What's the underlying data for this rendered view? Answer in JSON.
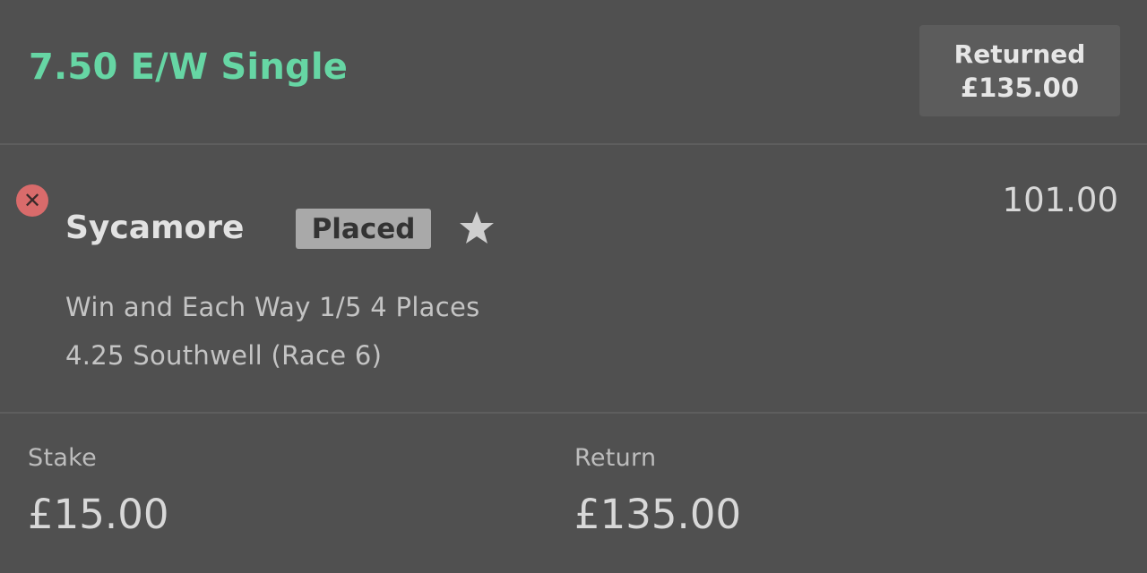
{
  "bet": {
    "title": "7.50 E/W Single",
    "title_color": "#66d6a4"
  },
  "returned": {
    "label": "Returned",
    "amount": "£135.00"
  },
  "selection": {
    "status_icon": "close-icon",
    "status_color": "#d96b6b",
    "runner": "Sycamore",
    "badge": "Placed",
    "favourite_icon": "star-icon",
    "odds": "101.00",
    "market": "Win and Each Way 1/5 4 Places",
    "event": "4.25 Southwell (Race 6)"
  },
  "summary": {
    "stake_label": "Stake",
    "stake_value": "£15.00",
    "return_label": "Return",
    "return_value": "£135.00"
  }
}
